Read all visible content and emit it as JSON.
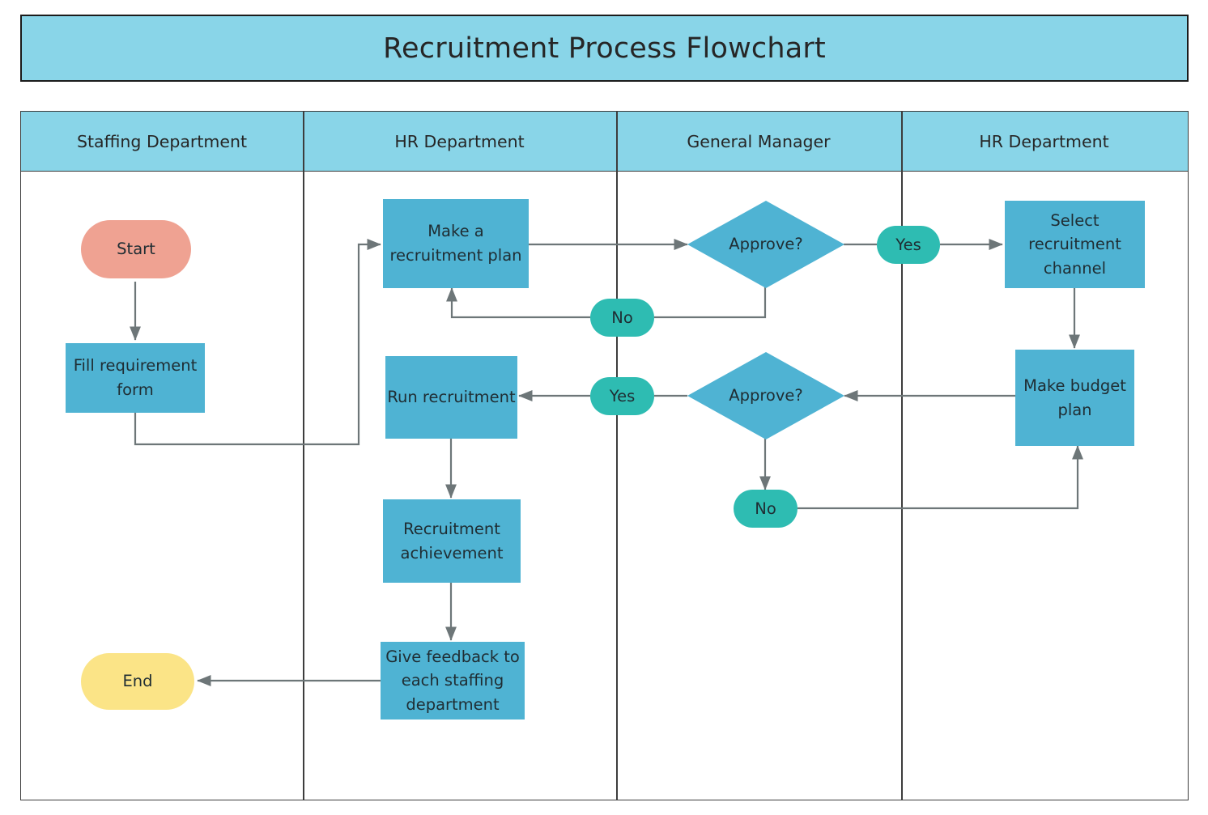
{
  "title": "Recruitment Process Flowchart",
  "colors": {
    "banner": "#89D5E8",
    "lane_header": "#89D5E8",
    "process": "#4FB3D3",
    "decision": "#4FB3D3",
    "start": "#EFA292",
    "end": "#FBE487",
    "pill": "#2EBCB2",
    "connector": "#6d7678",
    "border": "#3d3d3d",
    "text": "#262626"
  },
  "lanes": [
    {
      "label": "Staffing Department"
    },
    {
      "label": "HR Department"
    },
    {
      "label": "General Manager"
    },
    {
      "label": "HR Department"
    }
  ],
  "nodes": {
    "start": "Start",
    "fill_requirement_form": "Fill requirement form",
    "make_recruitment_plan": "Make a recruitment plan",
    "approve_1": "Approve?",
    "yes_1": "Yes",
    "no_1": "No",
    "select_recruitment_channel": "Select recruitment channel",
    "make_budget_plan": "Make budget plan",
    "approve_2": "Approve?",
    "yes_2": "Yes",
    "no_2": "No",
    "run_recruitment": "Run recruitment",
    "recruitment_achievement": "Recruitment achievement",
    "give_feedback": "Give feedback to each staffing department",
    "end": "End"
  }
}
